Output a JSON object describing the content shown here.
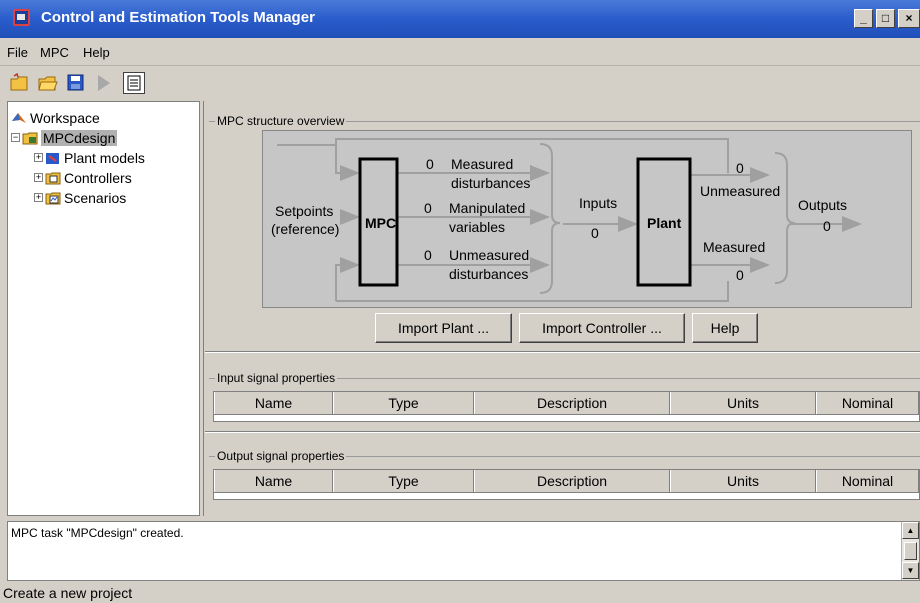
{
  "window": {
    "title": "Control and Estimation Tools Manager",
    "minimize": "_",
    "maximize": "□",
    "close": "×"
  },
  "menu": {
    "items": [
      "File",
      "MPC",
      "Help"
    ]
  },
  "toolbar": {
    "icons": [
      "new-project-icon",
      "open-project-icon",
      "save-icon",
      "run-icon",
      "notes-icon"
    ]
  },
  "tree": {
    "root": "Workspace",
    "project": "MPCdesign",
    "children": [
      "Plant models",
      "Controllers",
      "Scenarios"
    ]
  },
  "overview": {
    "group_label": "MPC structure overview",
    "mpc": "MPC",
    "plant": "Plant",
    "setpoints": [
      "Setpoints",
      "(reference)"
    ],
    "md_count": "0",
    "md_label": [
      "Measured",
      "disturbances"
    ],
    "mv_count": "0",
    "mv_label": [
      "Manipulated",
      "variables"
    ],
    "ud_count": "0",
    "ud_label": [
      "Unmeasured",
      "disturbances"
    ],
    "inputs_label": "Inputs",
    "inputs_count": "0",
    "unmeasured_count": "0",
    "unmeasured_label": "Unmeasured",
    "measured_label": "Measured",
    "measured_count": "0",
    "outputs_label": "Outputs",
    "outputs_count": "0"
  },
  "buttons": {
    "import_plant": "Import Plant ...",
    "import_controller": "Import Controller ...",
    "help": "Help"
  },
  "input_table": {
    "group_label": "Input signal properties",
    "columns": [
      "Name",
      "Type",
      "Description",
      "Units",
      "Nominal"
    ]
  },
  "output_table": {
    "group_label": "Output signal properties",
    "columns": [
      "Name",
      "Type",
      "Description",
      "Units",
      "Nominal"
    ]
  },
  "log": {
    "text": "MPC task \"MPCdesign\" created."
  },
  "status": {
    "text": "Create a new project"
  }
}
